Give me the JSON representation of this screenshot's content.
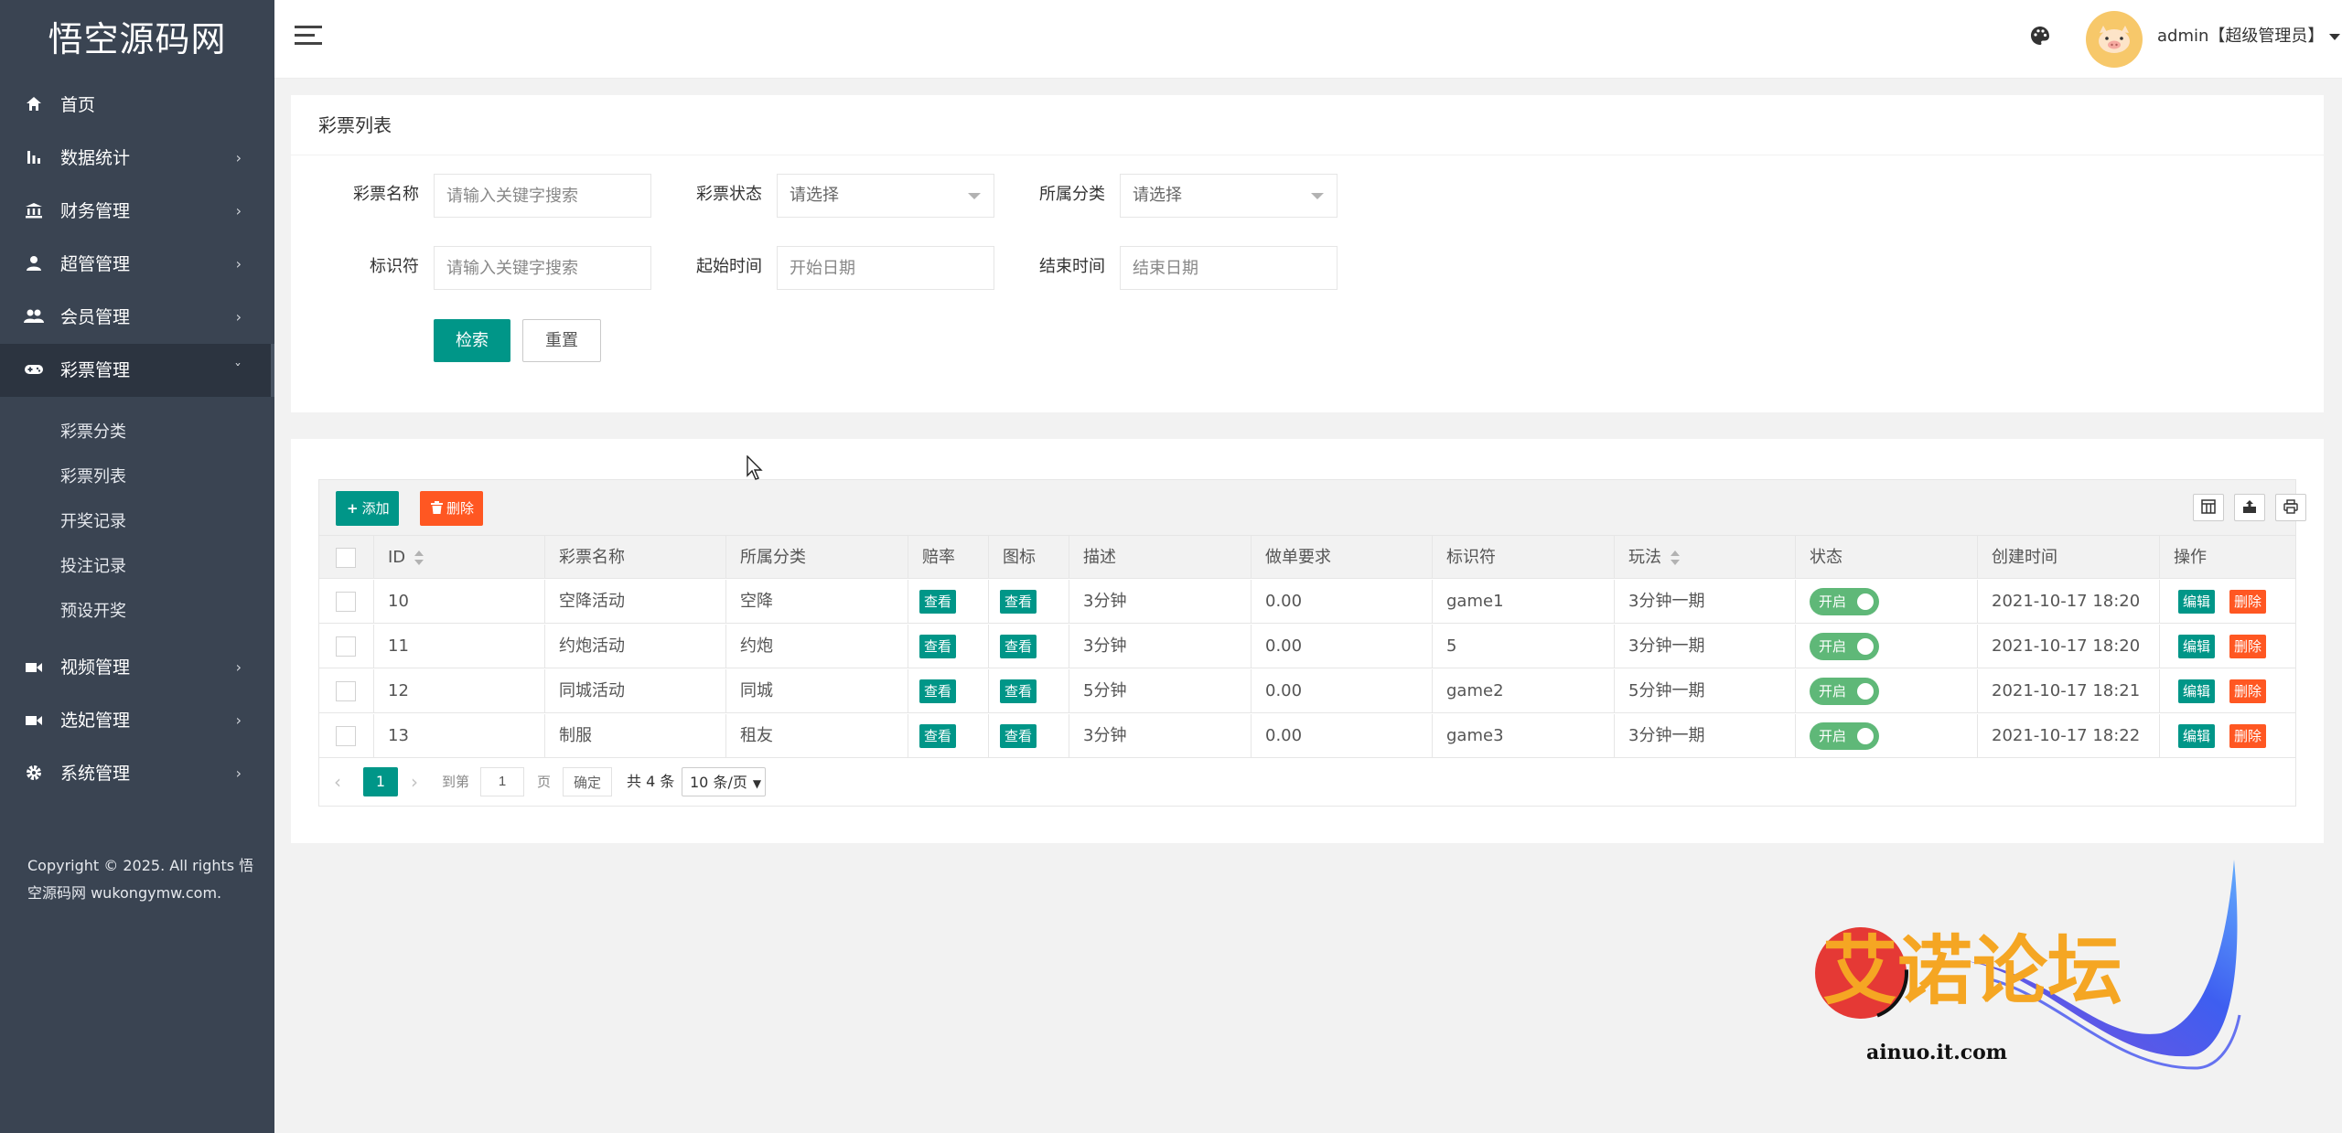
{
  "app": {
    "logo": "悟空源码网"
  },
  "sidebar": {
    "items": [
      {
        "label": "首页",
        "icon": "home-icon",
        "has_arrow": false
      },
      {
        "label": "数据统计",
        "icon": "bar-chart-icon",
        "has_arrow": true
      },
      {
        "label": "财务管理",
        "icon": "bank-icon",
        "has_arrow": true
      },
      {
        "label": "超管管理",
        "icon": "user-icon",
        "has_arrow": true
      },
      {
        "label": "会员管理",
        "icon": "users-icon",
        "has_arrow": true
      },
      {
        "label": "彩票管理",
        "icon": "gamepad-icon",
        "has_arrow": true,
        "open": true
      }
    ],
    "submenu": [
      "彩票分类",
      "彩票列表",
      "开奖记录",
      "投注记录",
      "预设开奖"
    ],
    "items_after": [
      {
        "label": "视频管理",
        "icon": "video-icon",
        "has_arrow": true
      },
      {
        "label": "选妃管理",
        "icon": "video-icon",
        "has_arrow": true
      },
      {
        "label": "系统管理",
        "icon": "gear-icon",
        "has_arrow": true
      }
    ],
    "copyright": "Copyright © 2025. All rights 悟空源码网 wukongymw.com."
  },
  "header": {
    "user": "admin【超级管理员】"
  },
  "search": {
    "title": "彩票列表",
    "name_label": "彩票名称",
    "name_placeholder": "请输入关键字搜索",
    "status_label": "彩票状态",
    "status_value": "请选择",
    "category_label": "所属分类",
    "category_value": "请选择",
    "key_label": "标识符",
    "key_placeholder": "请输入关键字搜索",
    "start_label": "起始时间",
    "start_placeholder": "开始日期",
    "end_label": "结束时间",
    "end_placeholder": "结束日期",
    "search_btn": "检索",
    "reset_btn": "重置"
  },
  "table": {
    "add_btn": "添加",
    "delete_btn": "删除",
    "headers": [
      "ID",
      "彩票名称",
      "所属分类",
      "赔率",
      "图标",
      "描述",
      "做单要求",
      "标识符",
      "玩法",
      "状态",
      "创建时间",
      "操作"
    ],
    "view_label": "查看",
    "switch_label": "开启",
    "edit_label": "编辑",
    "del_label": "删除",
    "rows": [
      {
        "id": "10",
        "name": "空降活动",
        "category": "空降",
        "desc": "3分钟",
        "req": "0.00",
        "key": "game1",
        "play": "3分钟一期",
        "created": "2021-10-17 18:20"
      },
      {
        "id": "11",
        "name": "约炮活动",
        "category": "约炮",
        "desc": "3分钟",
        "req": "0.00",
        "key": "5",
        "play": "3分钟一期",
        "created": "2021-10-17 18:20"
      },
      {
        "id": "12",
        "name": "同城活动",
        "category": "同城",
        "desc": "5分钟",
        "req": "0.00",
        "key": "game2",
        "play": "5分钟一期",
        "created": "2021-10-17 18:21"
      },
      {
        "id": "13",
        "name": "制服",
        "category": "租友",
        "desc": "3分钟",
        "req": "0.00",
        "key": "game3",
        "play": "3分钟一期",
        "created": "2021-10-17 18:22"
      }
    ]
  },
  "pager": {
    "current": "1",
    "goto_label": "到第",
    "goto_value": "1",
    "page_unit": "页",
    "confirm": "确定",
    "total": "共 4 条",
    "per_page": "10 条/页"
  },
  "watermark": {
    "text": "艾诺论坛",
    "url": "ainuo.it.com"
  },
  "colors": {
    "sidebar": "#3a4452",
    "primary": "#009688",
    "danger": "#ff5722",
    "switch": "#5fb878"
  }
}
